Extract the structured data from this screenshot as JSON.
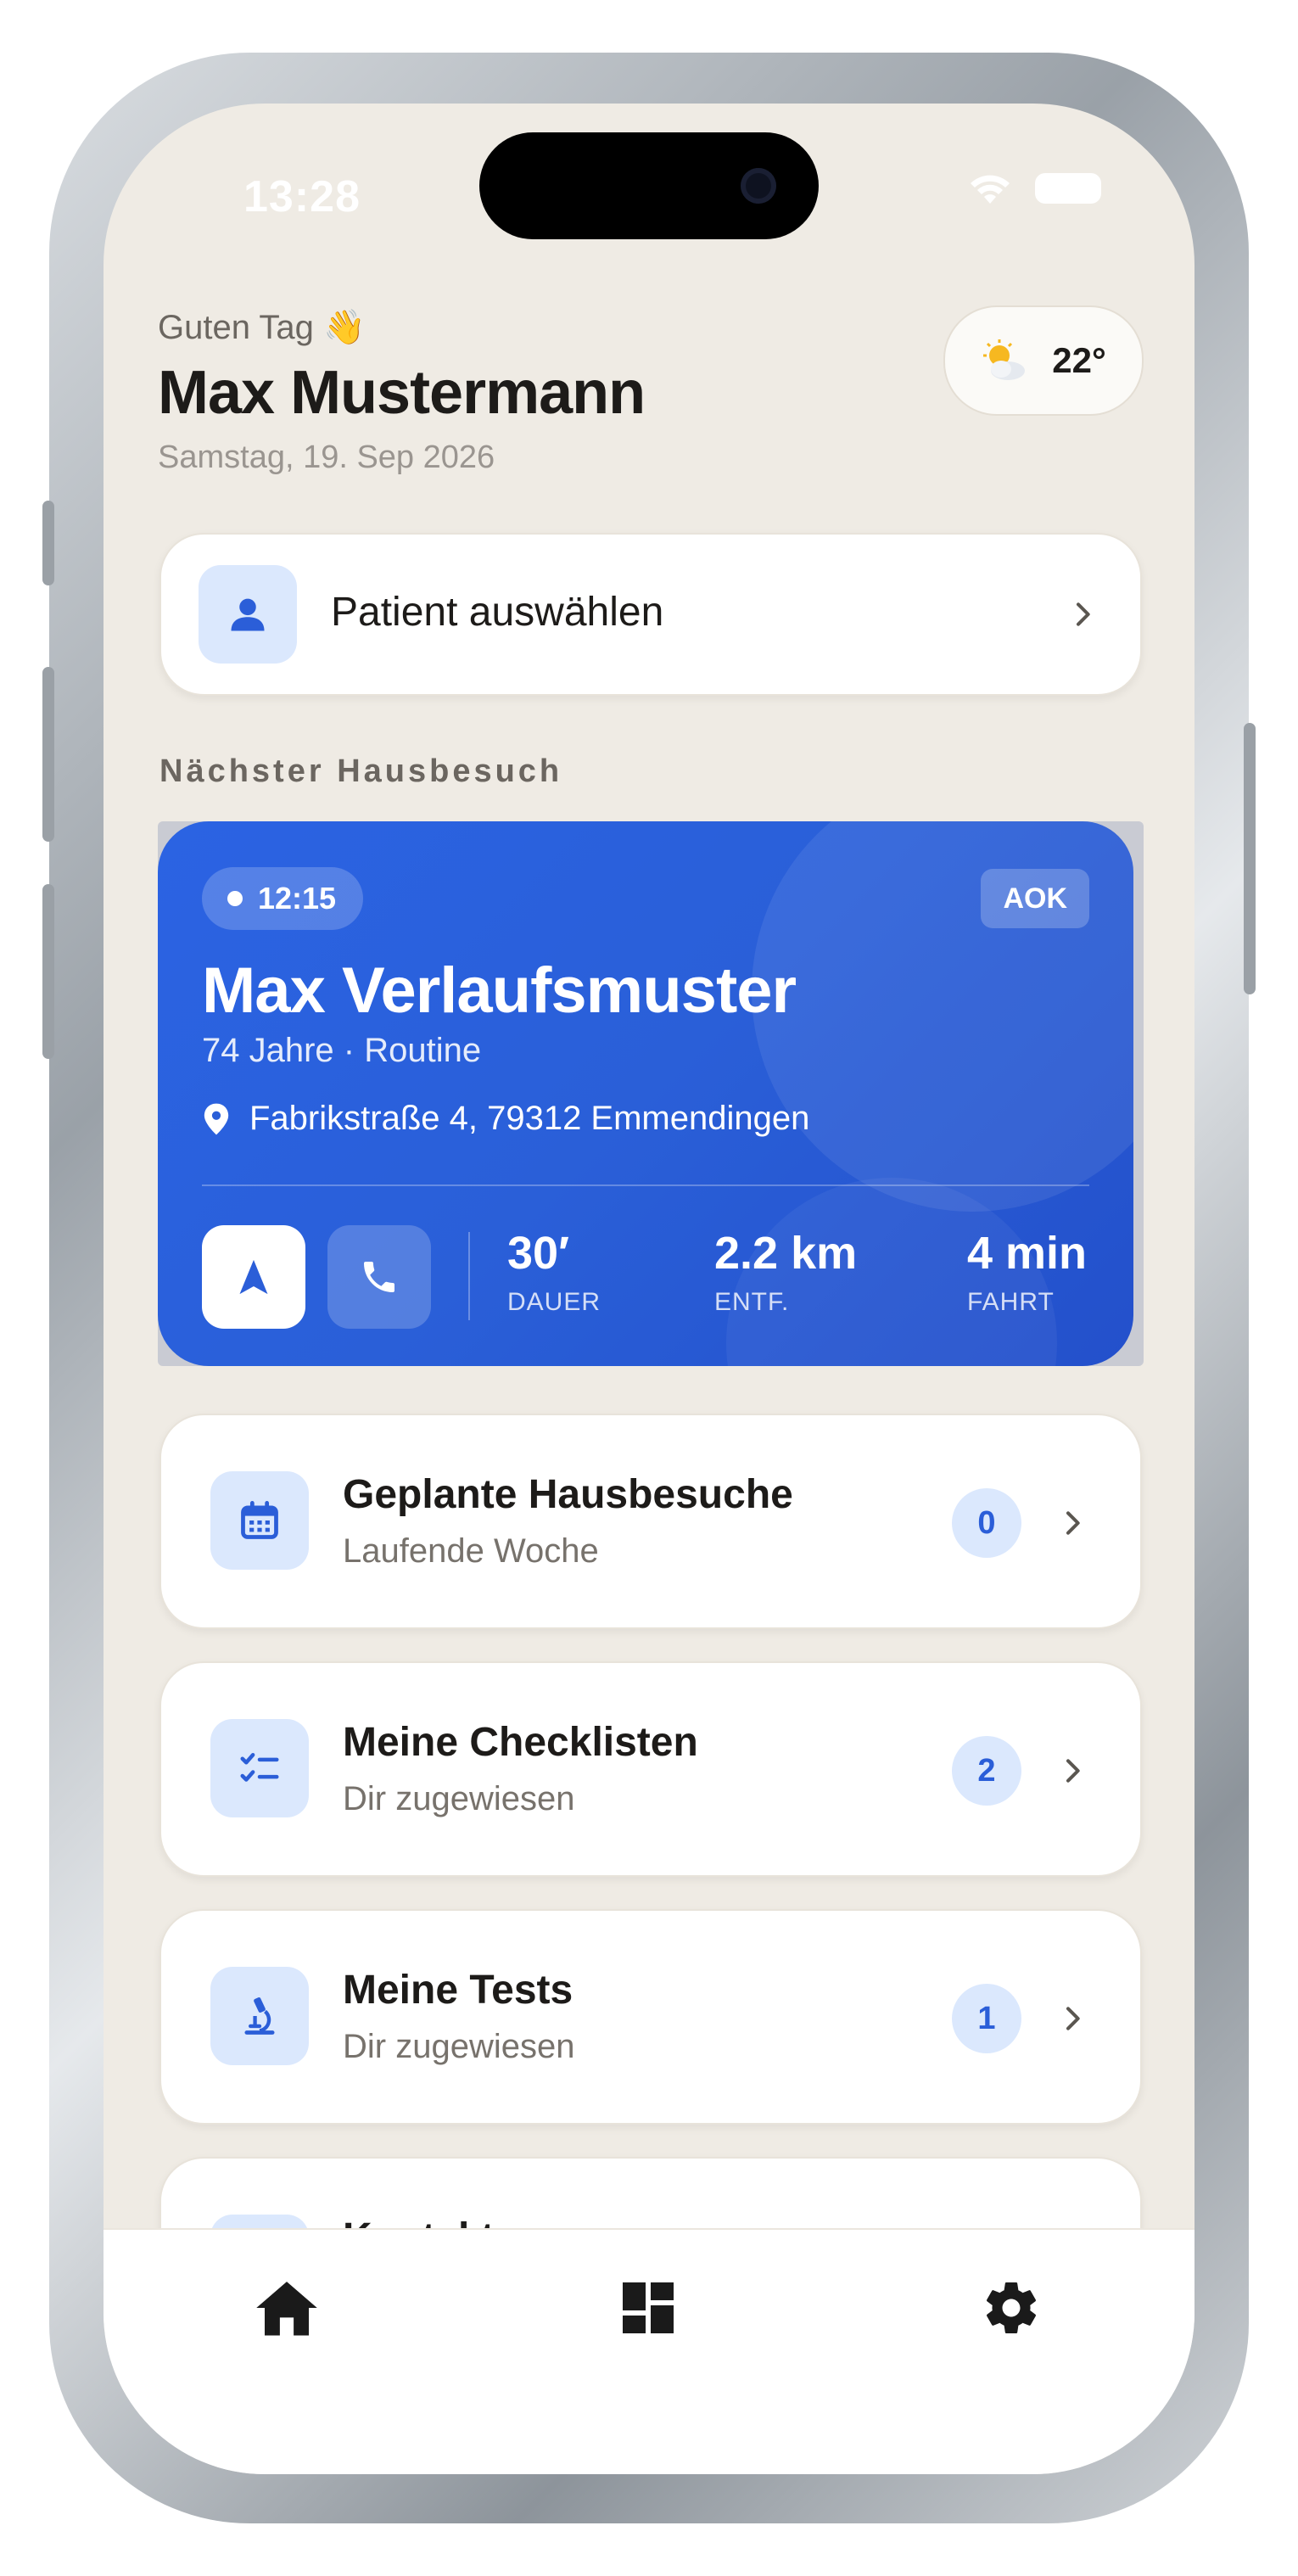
{
  "status_bar": {
    "time": "13:28"
  },
  "header": {
    "greeting": "Guten Tag 👋",
    "user_name": "Max Mustermann",
    "date": "Samstag, 19. Sep 2026",
    "weather": {
      "icon": "partly-sunny-icon",
      "temperature": "22°"
    }
  },
  "patient_select": {
    "label": "Patient auswählen"
  },
  "next_visit": {
    "section_title": "Nächster Hausbesuch",
    "time": "12:15",
    "insurance": "AOK",
    "patient_name": "Max Verlaufsmuster",
    "meta": "74 Jahre · Routine",
    "address": "Fabrikstraße 4, 79312 Emmendingen",
    "stats": [
      {
        "value": "30′",
        "label": "DAUER"
      },
      {
        "value": "2.2 km",
        "label": "ENTF."
      },
      {
        "value": "4 min",
        "label": "FAHRT"
      }
    ]
  },
  "list": [
    {
      "title": "Geplante Hausbesuche",
      "subtitle": "Laufende Woche",
      "count": "0",
      "icon": "calendar-icon"
    },
    {
      "title": "Meine Checklisten",
      "subtitle": "Dir zugewiesen",
      "count": "2",
      "icon": "checklist-icon"
    },
    {
      "title": "Meine Tests",
      "subtitle": "Dir zugewiesen",
      "count": "1",
      "icon": "microscope-icon"
    },
    {
      "title": "Kontakte",
      "subtitle": "",
      "count": "",
      "icon": "contacts-icon"
    }
  ],
  "tabbar": {
    "items": [
      "home-icon",
      "dashboard-icon",
      "settings-icon"
    ]
  },
  "colors": {
    "accent": "#2B5ED8",
    "background": "#EFEBE4",
    "tile": "#DBE8FD"
  }
}
